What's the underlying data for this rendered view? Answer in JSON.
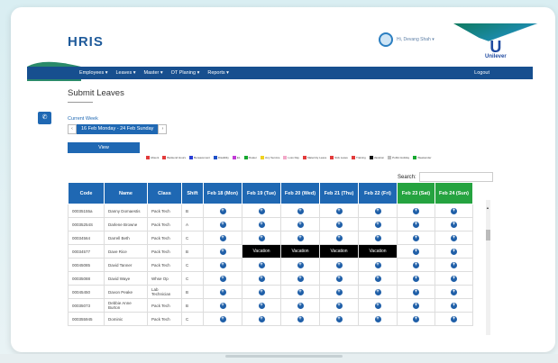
{
  "app": {
    "brand": "HRIS",
    "greeting": "Hi, Devang Shah ▾",
    "logo": "Unilever"
  },
  "nav": {
    "items": [
      "Employees ▾",
      "Leaves ▾",
      "Master ▾",
      "OT Planing ▾",
      "Reports ▾"
    ],
    "logout": "Logout"
  },
  "page": {
    "title": "Submit Leaves",
    "current_week_label": "Current Week",
    "week_range": "16 Feb Monday - 24 Feb Sunday",
    "prev": "‹",
    "next": "›",
    "view_button": "View"
  },
  "legend": [
    {
      "label": "Absent",
      "color": "#e23b3b"
    },
    {
      "label": "Bankend Hours",
      "color": "#e23b3b"
    },
    {
      "label": "Bereavement",
      "color": "#2a3fd6"
    },
    {
      "label": "Disability",
      "color": "#1e50c8"
    },
    {
      "label": "EL",
      "color": "#c23bd6"
    },
    {
      "label": "Floater",
      "color": "#16a830"
    },
    {
      "label": "Jury Service",
      "color": "#f0d21f"
    },
    {
      "label": "Loss Day",
      "color": "#f2a8c8"
    },
    {
      "label": "Maternity Leave",
      "color": "#e23b3b"
    },
    {
      "label": "Sick Leave",
      "color": "#e23b3b"
    },
    {
      "label": "Training",
      "color": "#e23b3b"
    },
    {
      "label": "Vacation",
      "color": "#111111"
    },
    {
      "label": "Public Holiday",
      "color": "#bdbdbd"
    },
    {
      "label": "Weekender",
      "color": "#16a830"
    }
  ],
  "search": {
    "label": "Search:"
  },
  "table": {
    "headers": [
      "Code",
      "Name",
      "Class",
      "Shift",
      "Feb 18 (Mon)",
      "Feb 19 (Tue)",
      "Feb 20 (Wed)",
      "Feb 21 (Thu)",
      "Feb 22 (Fri)",
      "Feb 23 (Sat)",
      "Feb 24 (Sun)"
    ],
    "vacation_label": "Vacation",
    "rows": [
      {
        "code": "00035155a",
        "name": "Danny Domaestis",
        "class": "Pack Tech",
        "shift": "B"
      },
      {
        "code": "00035254S",
        "name": "Darlene Browne",
        "class": "Pack Tech",
        "shift": "A"
      },
      {
        "code": "00034564",
        "name": "Darrell Beth",
        "class": "Pack Tech",
        "shift": "C"
      },
      {
        "code": "00034577",
        "name": "Dave Rice",
        "class": "Pack Tech",
        "shift": "B",
        "vacation": [
          1,
          2,
          3,
          4
        ]
      },
      {
        "code": "00045085",
        "name": "David Tanner",
        "class": "Pack Tech",
        "shift": "C"
      },
      {
        "code": "00035088",
        "name": "David Waye",
        "class": "Whse Op",
        "shift": "C"
      },
      {
        "code": "00045450",
        "name": "Davon Peake",
        "class": "Lab Technician",
        "shift": "B"
      },
      {
        "code": "00035073",
        "name": "Debbie Anne Burton",
        "class": "Pack Tech",
        "shift": "B"
      },
      {
        "code": "000355945",
        "name": "Dominic",
        "class": "Pack Tech",
        "shift": "C"
      }
    ]
  }
}
